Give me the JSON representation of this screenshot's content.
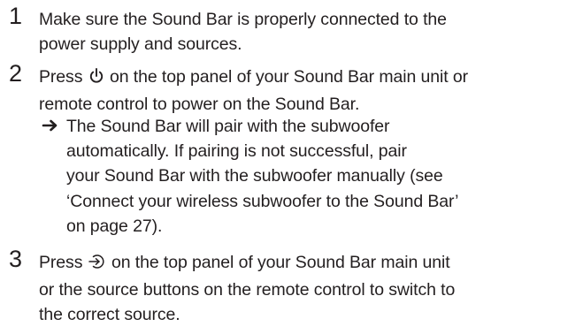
{
  "steps": [
    {
      "number": "1",
      "lines": [
        "Make sure the Sound Bar is properly connected to the",
        "power supply and sources."
      ]
    },
    {
      "number": "2",
      "line1_before_icon": "Press ",
      "icon": "power-icon",
      "line1_after_icon": " on the top panel of your Sound Bar main unit or",
      "line2": "remote control to power on the Sound Bar.",
      "result": {
        "arrow": "➔",
        "lines": [
          "The Sound Bar will pair with the subwoofer",
          "automatically. If pairing is not successful, pair",
          "your Sound Bar with the subwoofer manually  (see",
          "‘Connect your wireless subwoofer to the Sound Bar’",
          "on page 27)."
        ]
      }
    },
    {
      "number": "3",
      "line1_before_icon": "Press ",
      "icon": "source-input-icon",
      "line1_after_icon": " on the top panel of your Sound Bar main unit",
      "line2": "or the source buttons on the remote control to switch to",
      "line3": "the correct source."
    }
  ]
}
